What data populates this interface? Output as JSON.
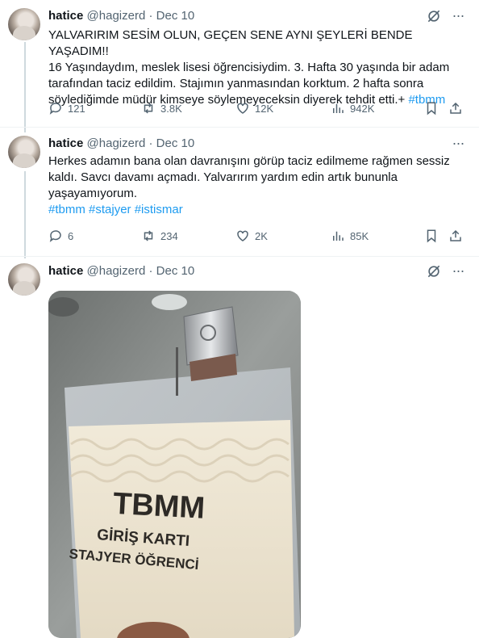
{
  "tweets": [
    {
      "name": "hatice",
      "handle": "@hagizerd",
      "dot": "·",
      "date": "Dec 10",
      "lines": [
        "YALVARIRIM SESİM OLUN, GEÇEN SENE AYNI ŞEYLERİ BENDE YAŞADIM!!",
        "16 Yaşındaydım, meslek lisesi öğrencisiydim. 3. Hafta 30 yaşında bir adam",
        "tarafından taciz edildim. Stajımın yanmasından korktum. 2 hafta sonra",
        "söylediğimde müdür kimseye söylemeyeceksin diyerek tehdit etti.+"
      ],
      "hashtag": "#tbmm",
      "replies": "121",
      "reposts": "3.8K",
      "likes": "12K",
      "views": "942K"
    },
    {
      "name": "hatice",
      "handle": "@hagizerd",
      "dot": "·",
      "date": "Dec 10",
      "lines": [
        "Herkes adamın bana olan davranışını görüp taciz edilmeme rağmen sessiz",
        "kaldı. Savcı davamı açmadı. Yalvarırım yardım edin artık bununla",
        "yaşayamıyorum."
      ],
      "hashtags": [
        "#tbmm",
        "#stajyer",
        "#istismar"
      ],
      "replies": "6",
      "reposts": "234",
      "likes": "2K",
      "views": "85K"
    },
    {
      "name": "hatice",
      "handle": "@hagizerd",
      "dot": "·",
      "date": "Dec 10"
    }
  ],
  "card": {
    "title": "TBMM",
    "subtitle": "GİRİŞ KARTI",
    "role": "STAJYER ÖĞRENCİ"
  },
  "icons": {
    "grok": "grok-icon",
    "more": "more-icon",
    "reply": "reply-icon",
    "repost": "repost-icon",
    "like": "like-icon",
    "views": "views-icon",
    "bookmark": "bookmark-icon",
    "share": "share-icon"
  },
  "colors": {
    "link": "#1d9bf0",
    "text": "#0f1419",
    "secondary": "#536471",
    "thread": "#cfd9de"
  }
}
